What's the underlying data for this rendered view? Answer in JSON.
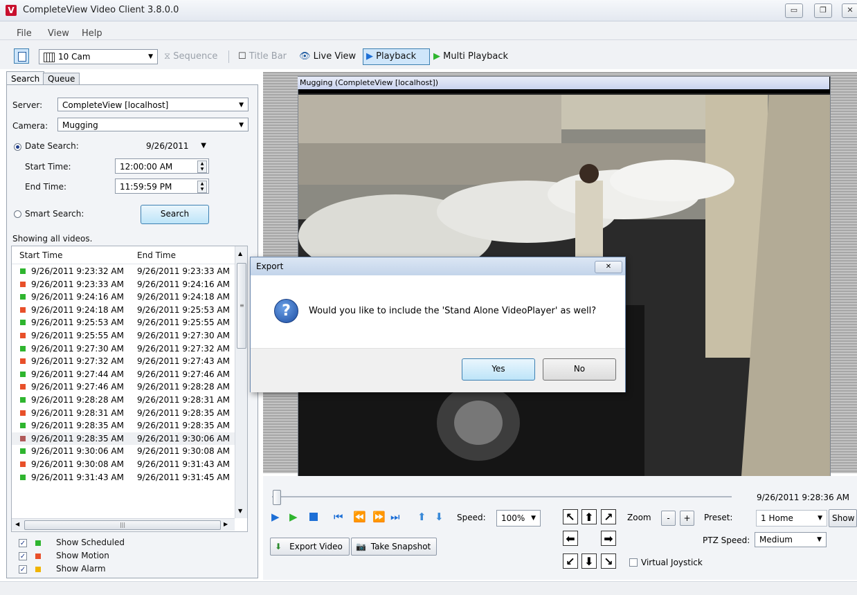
{
  "window": {
    "title": "CompleteView Video Client 3.8.0.0",
    "app_icon": "V"
  },
  "menu": [
    "File",
    "View",
    "Help"
  ],
  "toolbar": {
    "layout": "10 Cam",
    "sequence": "Sequence",
    "title_bar": "Title Bar",
    "live_view": "Live View",
    "playback": "Playback",
    "multi_playback": "Multi Playback"
  },
  "tabs": {
    "search": "Search",
    "queue": "Queue"
  },
  "search": {
    "server_label": "Server:",
    "server_value": "CompleteView [localhost]",
    "camera_label": "Camera:",
    "camera_value": "Mugging",
    "date_search_label": "Date Search:",
    "date_value": "9/26/2011",
    "start_time_label": "Start Time:",
    "start_time_value": "12:00:00 AM",
    "end_time_label": "End Time:",
    "end_time_value": "11:59:59 PM",
    "smart_search_label": "Smart Search:",
    "search_button": "Search",
    "showing": "Showing all videos."
  },
  "list": {
    "col_start": "Start Time",
    "col_end": "End Time",
    "rows": [
      {
        "start": "9/26/2011 9:23:32 AM",
        "end": "9/26/2011 9:23:33 AM",
        "type": "scheduled"
      },
      {
        "start": "9/26/2011 9:23:33 AM",
        "end": "9/26/2011 9:24:16 AM",
        "type": "motion"
      },
      {
        "start": "9/26/2011 9:24:16 AM",
        "end": "9/26/2011 9:24:18 AM",
        "type": "scheduled"
      },
      {
        "start": "9/26/2011 9:24:18 AM",
        "end": "9/26/2011 9:25:53 AM",
        "type": "motion"
      },
      {
        "start": "9/26/2011 9:25:53 AM",
        "end": "9/26/2011 9:25:55 AM",
        "type": "scheduled"
      },
      {
        "start": "9/26/2011 9:25:55 AM",
        "end": "9/26/2011 9:27:30 AM",
        "type": "motion"
      },
      {
        "start": "9/26/2011 9:27:30 AM",
        "end": "9/26/2011 9:27:32 AM",
        "type": "scheduled"
      },
      {
        "start": "9/26/2011 9:27:32 AM",
        "end": "9/26/2011 9:27:43 AM",
        "type": "motion"
      },
      {
        "start": "9/26/2011 9:27:44 AM",
        "end": "9/26/2011 9:27:46 AM",
        "type": "scheduled"
      },
      {
        "start": "9/26/2011 9:27:46 AM",
        "end": "9/26/2011 9:28:28 AM",
        "type": "motion"
      },
      {
        "start": "9/26/2011 9:28:28 AM",
        "end": "9/26/2011 9:28:31 AM",
        "type": "scheduled"
      },
      {
        "start": "9/26/2011 9:28:31 AM",
        "end": "9/26/2011 9:28:35 AM",
        "type": "motion"
      },
      {
        "start": "9/26/2011 9:28:35 AM",
        "end": "9/26/2011 9:28:35 AM",
        "type": "scheduled"
      },
      {
        "start": "9/26/2011 9:28:35 AM",
        "end": "9/26/2011 9:30:06 AM",
        "type": "motion-selected"
      },
      {
        "start": "9/26/2011 9:30:06 AM",
        "end": "9/26/2011 9:30:08 AM",
        "type": "scheduled"
      },
      {
        "start": "9/26/2011 9:30:08 AM",
        "end": "9/26/2011 9:31:43 AM",
        "type": "motion"
      },
      {
        "start": "9/26/2011 9:31:43 AM",
        "end": "9/26/2011 9:31:45 AM",
        "type": "scheduled"
      }
    ]
  },
  "legend": {
    "scheduled": "Show Scheduled",
    "motion": "Show Motion",
    "alarm": "Show Alarm"
  },
  "colors": {
    "scheduled": "#2fb52f",
    "motion": "#e8502a",
    "alarm": "#f0b400",
    "selected": "#b05a5a"
  },
  "video": {
    "title": "Mugging (CompleteView [localhost])"
  },
  "dialog": {
    "title": "Export",
    "close": "✕",
    "message": "Would you like to include the 'Stand Alone VideoPlayer' as well?",
    "yes": "Yes",
    "no": "No"
  },
  "playback": {
    "timestamp": "9/26/2011 9:28:36 AM",
    "speed_label": "Speed:",
    "speed_value": "100%",
    "export_video": "Export Video",
    "take_snapshot": "Take Snapshot"
  },
  "ptz": {
    "zoom_label": "Zoom",
    "zoom_out": "-",
    "zoom_in": "+",
    "preset_label": "Preset:",
    "preset_value": "1 Home",
    "show": "Show",
    "speed_label": "PTZ Speed:",
    "speed_value": "Medium",
    "virtual_joystick": "Virtual Joystick"
  }
}
